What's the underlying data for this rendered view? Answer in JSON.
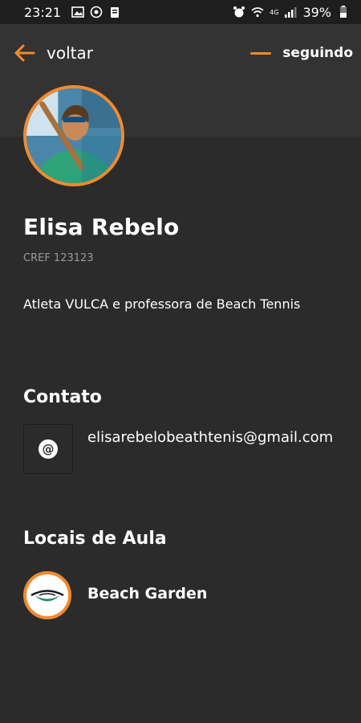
{
  "status_bar": {
    "time": "23:21",
    "network": "4G",
    "battery": "39%"
  },
  "header": {
    "back_label": "voltar",
    "follow_label": "seguindo"
  },
  "profile": {
    "name": "Elisa Rebelo",
    "cref": "CREF 123123",
    "bio": "Atleta VULCA e professora de Beach Tennis"
  },
  "contact": {
    "title": "Contato",
    "email": "elisarebelobeathtenis@gmail.com",
    "email_icon": "@"
  },
  "places": {
    "title": "Locais de Aula",
    "items": [
      {
        "name": "Beach Garden"
      }
    ]
  },
  "colors": {
    "background": "#2b2b2b",
    "accent": "#f28a2e",
    "muted_text": "#9a9a9a"
  }
}
